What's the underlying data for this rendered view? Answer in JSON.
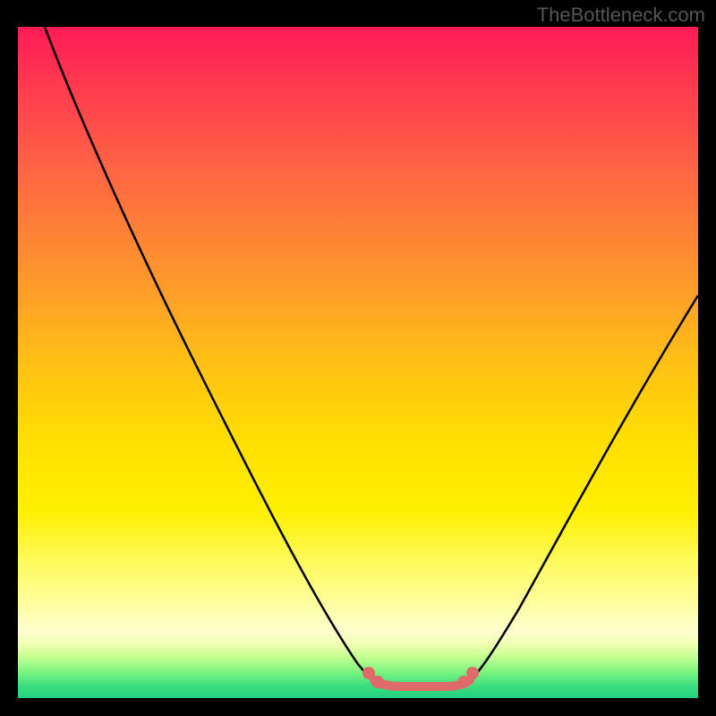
{
  "watermark": "TheBottleneck.com",
  "chart_data": {
    "type": "line",
    "title": "",
    "xlabel": "",
    "ylabel": "",
    "xlim": [
      0,
      100
    ],
    "ylim": [
      0,
      100
    ],
    "background_gradient": {
      "top_color": "#ff1a55",
      "mid_color": "#ffe000",
      "bottom_color": "#20d080"
    },
    "series": [
      {
        "name": "left-curve",
        "color": "#000000",
        "x": [
          4,
          10,
          20,
          30,
          40,
          48,
          51
        ],
        "y": [
          100,
          88,
          69,
          49,
          28,
          9,
          3
        ]
      },
      {
        "name": "right-curve",
        "color": "#000000",
        "x": [
          66,
          70,
          80,
          90,
          100
        ],
        "y": [
          3,
          9,
          27,
          45,
          60
        ]
      },
      {
        "name": "bottom-flat",
        "color": "#e57373",
        "x": [
          51,
          53,
          56,
          60,
          63,
          65,
          66
        ],
        "y": [
          3,
          2,
          2,
          2,
          2,
          2.5,
          3
        ]
      }
    ],
    "markers": [
      {
        "x": 51,
        "y": 3,
        "color": "#e57373"
      },
      {
        "x": 53,
        "y": 2,
        "color": "#e57373"
      },
      {
        "x": 65,
        "y": 2.5,
        "color": "#e57373"
      },
      {
        "x": 66,
        "y": 3,
        "color": "#e57373"
      }
    ]
  }
}
